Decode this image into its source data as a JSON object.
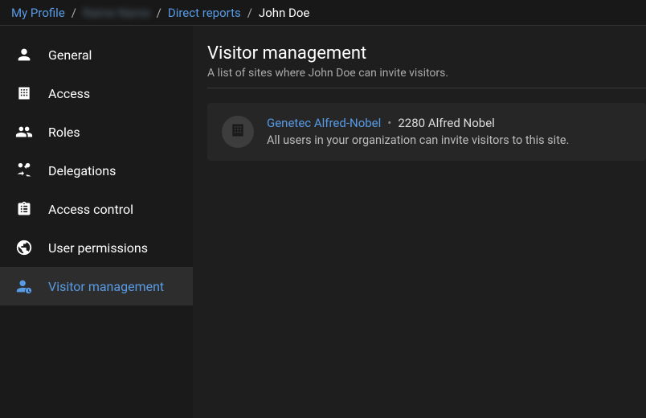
{
  "breadcrumb": {
    "my_profile": "My Profile",
    "redacted": "Name Name",
    "direct_reports": "Direct reports",
    "current": "John Doe"
  },
  "sidebar": {
    "items": [
      {
        "label": "General"
      },
      {
        "label": "Access"
      },
      {
        "label": "Roles"
      },
      {
        "label": "Delegations"
      },
      {
        "label": "Access control"
      },
      {
        "label": "User permissions"
      },
      {
        "label": "Visitor management"
      }
    ]
  },
  "main": {
    "title": "Visitor management",
    "subtitle": "A list of sites where John Doe can invite visitors."
  },
  "site": {
    "name": "Genetec Alfred-Nobel",
    "address": "2280 Alfred Nobel",
    "description": "All users in your organization can invite visitors to this site."
  }
}
